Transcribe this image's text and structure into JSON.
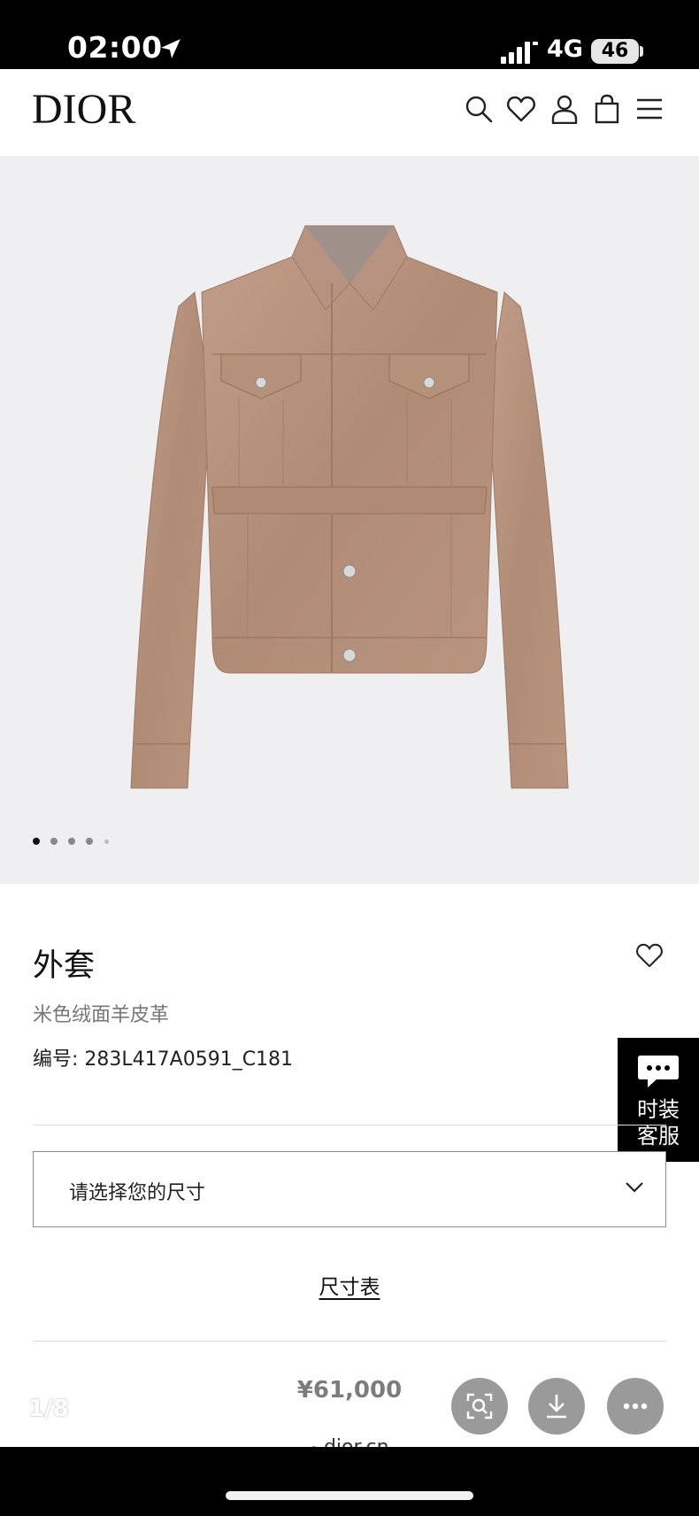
{
  "status_bar": {
    "time": "02:00",
    "network": "4G",
    "battery": "46",
    "icons": [
      "location-arrow-icon",
      "cellular-signal-icon"
    ]
  },
  "header": {
    "logo": "DIOR",
    "icons": [
      "search-icon",
      "heart-icon",
      "user-icon",
      "shopping-bag-icon",
      "menu-icon"
    ]
  },
  "gallery": {
    "image": "beige suede jacket",
    "total_dots": 5,
    "active_dot": 1
  },
  "product": {
    "title": "外套",
    "subtitle": "米色绒面羊皮革",
    "sku_label": "编号:",
    "sku_value": "283L417A0591_C181",
    "price": "¥61,000"
  },
  "chat_widget": {
    "line1": "时装",
    "line2": "客服"
  },
  "size_select": {
    "placeholder": "请选择您的尺寸"
  },
  "size_chart": {
    "label": "尺寸表"
  },
  "browser": {
    "domain": "dior.cn",
    "page_counter": "1/8"
  },
  "colors": {
    "gallery_bg": "#efeff1",
    "jacket": "#b38f7a",
    "text_primary": "#111111",
    "text_muted": "#777777"
  }
}
